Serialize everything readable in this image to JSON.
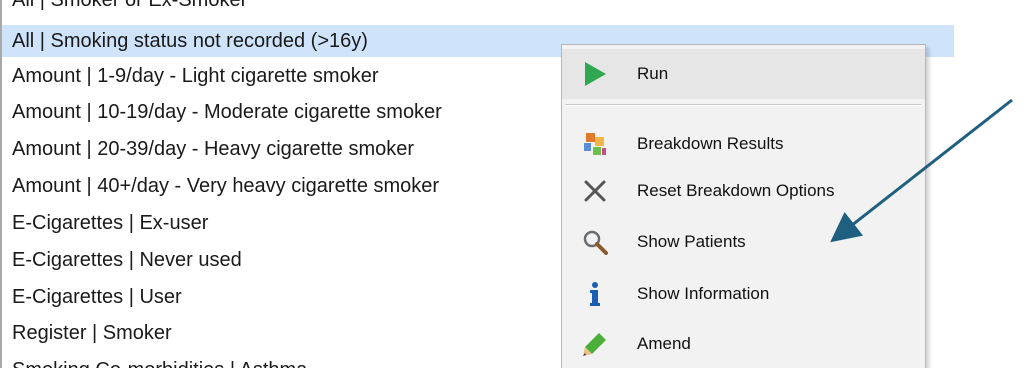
{
  "list": {
    "items": [
      "All | Smoker or Ex-Smoker",
      "All | Smoking status not recorded (>16y)",
      "Amount | 1-9/day - Light cigarette smoker",
      "Amount | 10-19/day - Moderate cigarette smoker",
      "Amount | 20-39/day - Heavy cigarette smoker",
      "Amount | 40+/day - Very heavy  cigarette smoker",
      "E-Cigarettes | Ex-user",
      "E-Cigarettes | Never used",
      "E-Cigarettes | User",
      "Register | Smoker",
      "Smoking Co-morbidities | Asthma"
    ],
    "selected_index": 1,
    "selected_color": "#cfe3fb"
  },
  "context_menu": {
    "items": [
      {
        "label": "Run",
        "icon": "play-icon"
      },
      {
        "label": "Breakdown Results",
        "icon": "breakdown-icon"
      },
      {
        "label": "Reset Breakdown Options",
        "icon": "close-icon"
      },
      {
        "label": "Show Patients",
        "icon": "magnifier-icon"
      },
      {
        "label": "Show Information",
        "icon": "info-icon"
      },
      {
        "label": "Amend",
        "icon": "pencil-icon"
      }
    ]
  },
  "annotation": {
    "arrow_color": "#1f5f80",
    "points_to": "Show Patients"
  },
  "colors": {
    "run_green": "#2fa84f",
    "info_blue": "#1a5fb4"
  }
}
